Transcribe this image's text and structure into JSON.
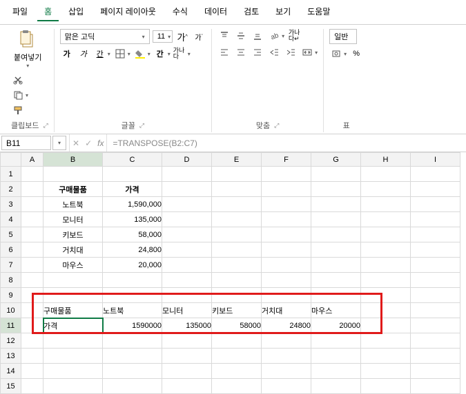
{
  "menu": {
    "items": [
      "파일",
      "홈",
      "삽입",
      "페이지 레이아웃",
      "수식",
      "데이터",
      "검토",
      "보기",
      "도움말"
    ],
    "active_index": 1
  },
  "ribbon": {
    "clipboard": {
      "paste": "붙여넣기",
      "label": "클립보드"
    },
    "font": {
      "font_name": "맑은 고딕",
      "font_size": "11",
      "bigA": "가",
      "smallA": "가",
      "bold": "가",
      "italic": "가",
      "underline": "간",
      "font_color": "간",
      "label": "글꼴"
    },
    "align": {
      "wrap": "가나다",
      "label": "맞춤"
    },
    "number": {
      "style": "일반",
      "label": "표"
    }
  },
  "formula_bar": {
    "cell_ref": "B11",
    "formula": "=TRANSPOSE(B2:C7)",
    "fx": "fx"
  },
  "columns": [
    "A",
    "B",
    "C",
    "D",
    "E",
    "F",
    "G",
    "H",
    "I"
  ],
  "rows": [
    "1",
    "2",
    "3",
    "4",
    "5",
    "6",
    "7",
    "8",
    "9",
    "10",
    "11",
    "12",
    "13",
    "14",
    "15"
  ],
  "table1": {
    "header": {
      "item": "구매물품",
      "price": "가격"
    },
    "rows": [
      {
        "item": "노트북",
        "price": "1,590,000"
      },
      {
        "item": "모니터",
        "price": "135,000"
      },
      {
        "item": "키보드",
        "price": "58,000"
      },
      {
        "item": "거치대",
        "price": "24,800"
      },
      {
        "item": "마우스",
        "price": "20,000"
      }
    ]
  },
  "table2": {
    "row1": {
      "b": "구매물품",
      "c": "노트북",
      "d": "모니터",
      "e": "키보드",
      "f": "거치대",
      "g": "마우스"
    },
    "row2": {
      "b": "가격",
      "c": "1590000",
      "d": "135000",
      "e": "58000",
      "f": "24800",
      "g": "20000"
    }
  },
  "selected": {
    "col": "B",
    "row": "11"
  }
}
